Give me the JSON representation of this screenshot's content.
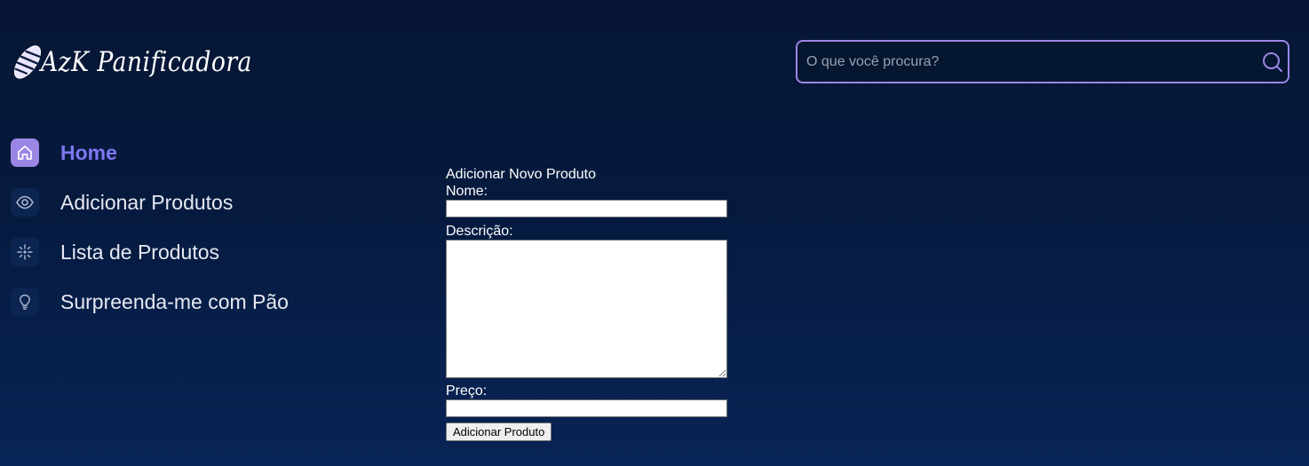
{
  "brand": {
    "name": "AzK Panificadora"
  },
  "search": {
    "placeholder": "O que você procura?",
    "value": ""
  },
  "sidebar": {
    "items": [
      {
        "label": "Home",
        "icon": "home-icon",
        "active": true
      },
      {
        "label": "Adicionar Produtos",
        "icon": "eye-icon",
        "active": false
      },
      {
        "label": "Lista de Produtos",
        "icon": "sparkle-icon",
        "active": false
      },
      {
        "label": "Surpreenda-me com Pão",
        "icon": "lightbulb-icon",
        "active": false
      }
    ]
  },
  "form": {
    "title": "Adicionar Novo Produto",
    "name_label": "Nome:",
    "name_value": "",
    "description_label": "Descrição:",
    "description_value": "",
    "price_label": "Preço:",
    "price_value": "",
    "submit_label": "Adicionar Produto"
  },
  "colors": {
    "accent": "#9b86e6",
    "active_text": "#7e77f2",
    "background_top": "#071634",
    "background_bottom": "#082456"
  }
}
